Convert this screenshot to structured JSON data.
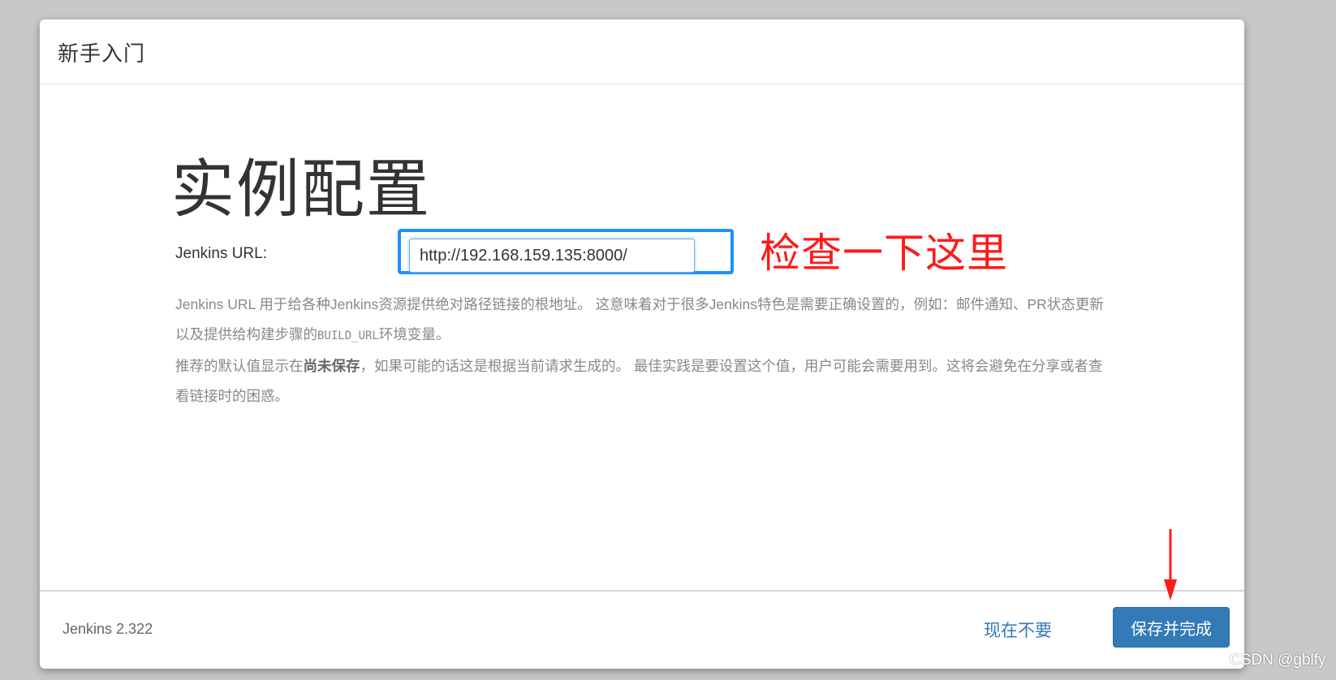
{
  "dialog": {
    "title": "新手入门"
  },
  "page": {
    "heading": "实例配置"
  },
  "form": {
    "url_label": "Jenkins URL:",
    "url_value": "http://192.168.159.135:8000/"
  },
  "help": {
    "p1_a": "Jenkins URL 用于给各种Jenkins资源提供绝对路径链接的根地址。 这意味着对于很多Jenkins特色是需要正确设置的，例如：邮件通知、PR状态更新以及提供给构建步骤的",
    "p1_code": "BUILD_URL",
    "p1_b": "环境变量。",
    "p2_a": "推荐的默认值显示在",
    "p2_bold": "尚未保存",
    "p2_b": "，如果可能的话这是根据当前请求生成的。 最佳实践是要设置这个值，用户可能会需要用到。这将会避免在分享或者查看链接时的困惑。"
  },
  "annotation": {
    "text": "检查一下这里",
    "color": "#ff1a1a"
  },
  "footer": {
    "version": "Jenkins 2.322",
    "skip_label": "现在不要",
    "save_label": "保存并完成"
  },
  "watermark": "CSDN @gblfy",
  "colors": {
    "primary": "#337ab7",
    "highlight": "#1e90ff"
  }
}
